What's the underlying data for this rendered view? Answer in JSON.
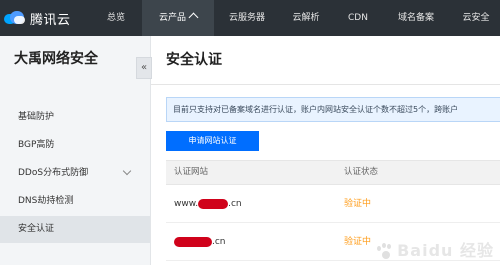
{
  "topbar": {
    "logo_text": "腾讯云",
    "nav": [
      "总览",
      "云产品",
      "云服务器",
      "云解析",
      "CDN",
      "域名备案",
      "云安全"
    ],
    "active_index": 1
  },
  "sidebar": {
    "title": "大禹网络安全",
    "collapse_glyph": "«",
    "items": [
      "基础防护",
      "BGP高防",
      "DDoS分布式防御",
      "DNS劫持检测",
      "安全认证"
    ],
    "active_index": 4
  },
  "main": {
    "title": "安全认证",
    "notice": "目前只支持对已备案域名进行认证，账户内网站安全认证个数不超过5个，跨账户",
    "apply_button": "申请网站认证",
    "table": {
      "headers": [
        "认证网站",
        "认证状态"
      ],
      "rows": [
        {
          "site_prefix": "www.",
          "site_suffix": ".cn",
          "status": "验证中"
        },
        {
          "site_prefix": "",
          "site_suffix": ".cn",
          "status": "验证中"
        }
      ]
    }
  },
  "watermark": {
    "text": "Baidu 经验"
  },
  "colors": {
    "topbar": "#2b3137",
    "accent": "#006eff",
    "pending": "#ff9c19",
    "redaction": "#d0021b"
  }
}
